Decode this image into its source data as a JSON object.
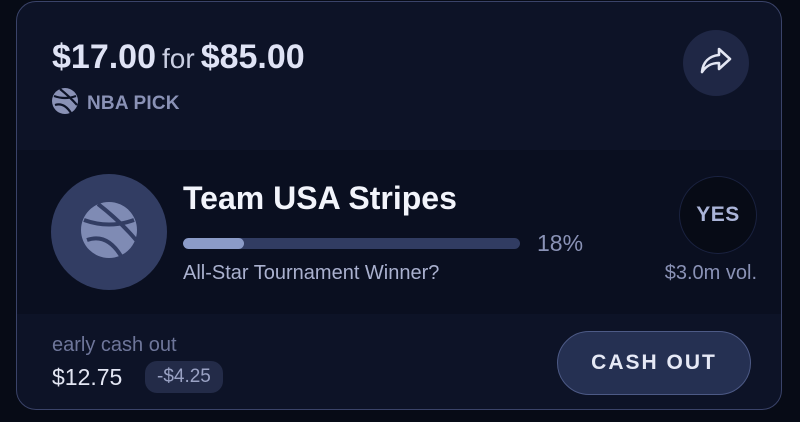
{
  "header": {
    "stake": "$17.00",
    "for_word": "for",
    "payout": "$85.00",
    "league_label": "NBA PICK",
    "league_icon": "basketball-icon",
    "share_icon": "share-arrow-icon"
  },
  "pick": {
    "team_icon": "basketball-icon",
    "team_name": "Team USA Stripes",
    "progress_fraction": 0.18,
    "percent_label": "18%",
    "question": "All-Star Tournament Winner?",
    "side_label": "YES",
    "volume_label": "$3.0m vol."
  },
  "footer": {
    "early_label": "early cash out",
    "cash_value": "$12.75",
    "delta": "-$4.25",
    "cashout_label": "CASH OUT"
  },
  "colors": {
    "card_bg": "#0d1327",
    "section_bg": "#0a0f20",
    "border": "#3a4369",
    "accent_fill": "#8b9bc8",
    "track": "#313c62",
    "muted_text": "#8a92b6"
  }
}
